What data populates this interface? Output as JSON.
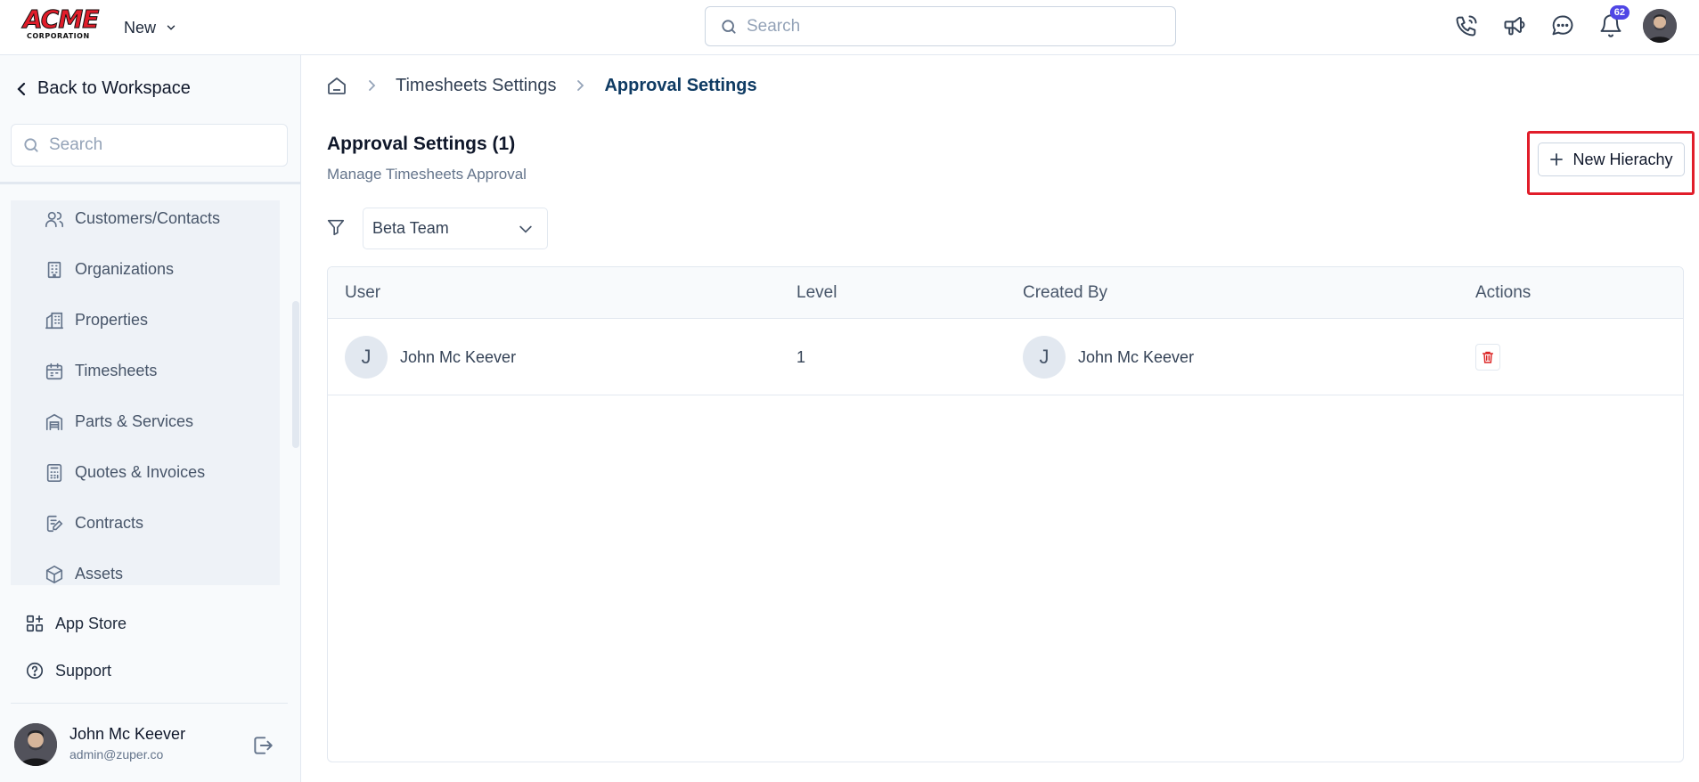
{
  "header": {
    "logo_text": "ACME",
    "logo_subtext": "CORPORATION",
    "new_label": "New",
    "search_placeholder": "Search",
    "notification_count": "62"
  },
  "sidebar": {
    "back_label": "Back to Workspace",
    "search_placeholder": "Search",
    "items": [
      {
        "label": "Customers/Contacts",
        "icon": "users-icon"
      },
      {
        "label": "Organizations",
        "icon": "building-icon"
      },
      {
        "label": "Properties",
        "icon": "properties-icon"
      },
      {
        "label": "Timesheets",
        "icon": "calendar-icon"
      },
      {
        "label": "Parts & Services",
        "icon": "warehouse-icon"
      },
      {
        "label": "Quotes & Invoices",
        "icon": "calculator-icon"
      },
      {
        "label": "Contracts",
        "icon": "contract-icon"
      },
      {
        "label": "Assets",
        "icon": "cube-icon"
      }
    ],
    "app_store_label": "App Store",
    "support_label": "Support",
    "user": {
      "name": "John Mc Keever",
      "email": "admin@zuper.co"
    }
  },
  "breadcrumb": {
    "parent": "Timesheets Settings",
    "current": "Approval Settings"
  },
  "page": {
    "title": "Approval Settings (1)",
    "subtitle": "Manage Timesheets Approval",
    "new_button_label": "New Hierachy",
    "team_filter_value": "Beta Team"
  },
  "table": {
    "headers": [
      "User",
      "Level",
      "Created By",
      "Actions"
    ],
    "rows": [
      {
        "user_initial": "J",
        "user": "John Mc Keever",
        "level": "1",
        "created_by_initial": "J",
        "created_by": "John Mc Keever"
      }
    ]
  },
  "colors": {
    "highlight": "#e11d2a",
    "badge": "#4f46e5",
    "delete": "#dc2626"
  }
}
